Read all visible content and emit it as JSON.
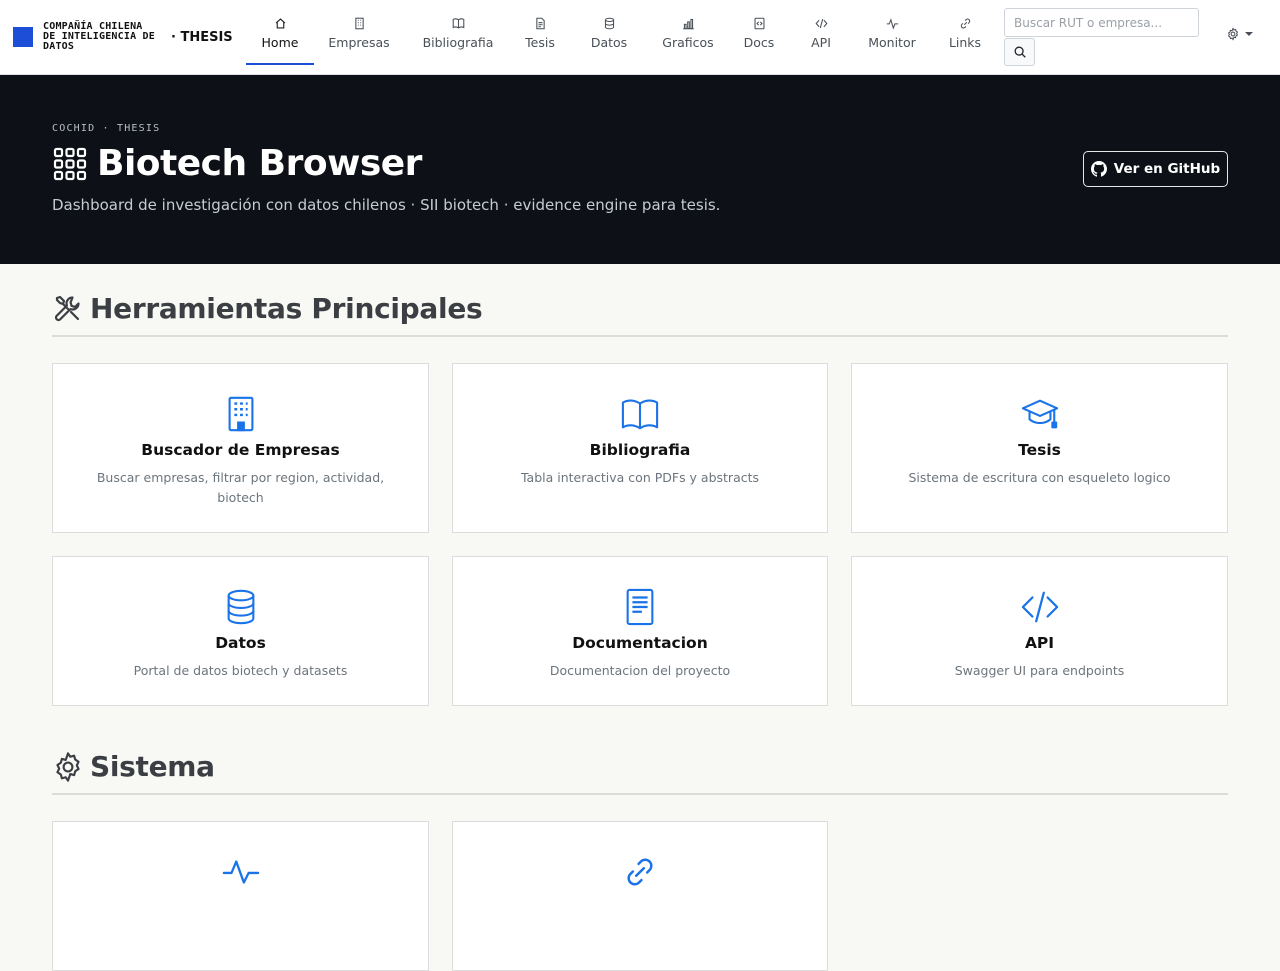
{
  "navbar": {
    "brand_name": "COMPAÑÍA CHILENA DE INTELIGENCIA DE DATOS",
    "brand_suffix": "· THESIS",
    "items": [
      {
        "label": "Home",
        "icon": "home-icon",
        "active": true
      },
      {
        "label": "Empresas",
        "icon": "building-icon"
      },
      {
        "label": "Bibliografia",
        "icon": "book-icon"
      },
      {
        "label": "Tesis",
        "icon": "file-text-icon"
      },
      {
        "label": "Datos",
        "icon": "database-icon"
      },
      {
        "label": "Graficos",
        "icon": "bar-chart-icon"
      },
      {
        "label": "Docs",
        "icon": "code-file-icon"
      },
      {
        "label": "API",
        "icon": "code-icon"
      },
      {
        "label": "Monitor",
        "icon": "activity-icon"
      },
      {
        "label": "Links",
        "icon": "link-icon"
      }
    ],
    "search_placeholder": "Buscar RUT o empresa...",
    "search_value": ""
  },
  "hero": {
    "eyebrow": "COCHID · THESIS",
    "title": "Biotech Browser",
    "subtitle": "Dashboard de investigación con datos chilenos · SII biotech · evidence engine para tesis.",
    "github_label": "Ver en GitHub"
  },
  "sections": [
    {
      "title": "Herramientas Principales",
      "icon": "tools-icon",
      "cards": [
        {
          "title": "Buscador de Empresas",
          "desc": "Buscar empresas, filtrar por region, actividad, biotech",
          "icon": "building-icon"
        },
        {
          "title": "Bibliografia",
          "desc": "Tabla interactiva con PDFs y abstracts",
          "icon": "book-icon"
        },
        {
          "title": "Tesis",
          "desc": "Sistema de escritura con esqueleto logico",
          "icon": "mortarboard-icon"
        },
        {
          "title": "Datos",
          "desc": "Portal de datos biotech y datasets",
          "icon": "database-icon"
        },
        {
          "title": "Documentacion",
          "desc": "Documentacion del proyecto",
          "icon": "file-text-icon"
        },
        {
          "title": "API",
          "desc": "Swagger UI para endpoints",
          "icon": "code-icon"
        }
      ]
    },
    {
      "title": "Sistema",
      "icon": "gear-icon",
      "cards": [
        {
          "title": "",
          "desc": "",
          "icon": "activity-icon"
        },
        {
          "title": "",
          "desc": "",
          "icon": "link-icon"
        }
      ]
    }
  ],
  "colors": {
    "accent": "#1d4ed8",
    "icon_blue": "#1a73e8",
    "hero_bg": "#0d1117",
    "page_bg": "#f8f8f4"
  }
}
